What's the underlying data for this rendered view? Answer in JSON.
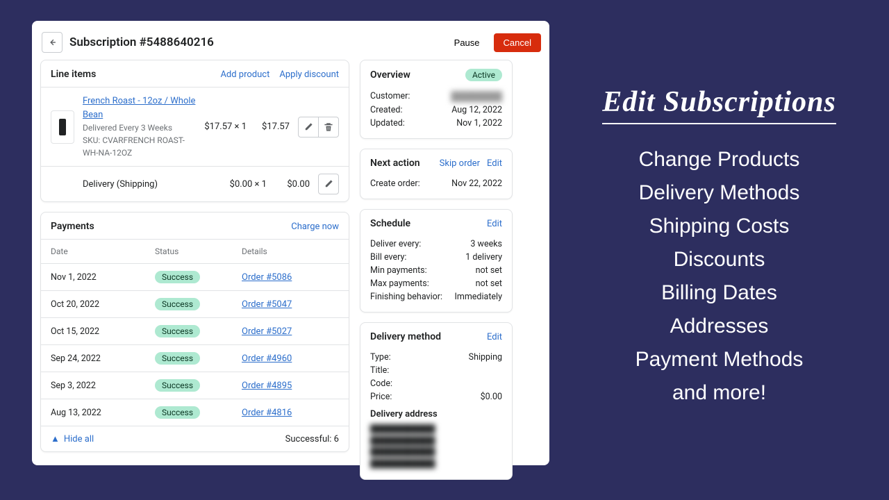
{
  "header": {
    "title": "Subscription #5488640216",
    "pause": "Pause",
    "cancel": "Cancel"
  },
  "lineItems": {
    "title": "Line items",
    "addProduct": "Add product",
    "applyDiscount": "Apply discount",
    "item": {
      "name": "French Roast - 12oz / Whole Bean",
      "schedule": "Delivered Every 3 Weeks",
      "sku": "SKU: CVARFRENCH ROAST-WH-NA-12OZ",
      "unitPrice": "$17.57 × 1",
      "total": "$17.57"
    },
    "delivery": {
      "label": "Delivery (Shipping)",
      "unitPrice": "$0.00 × 1",
      "total": "$0.00"
    }
  },
  "payments": {
    "title": "Payments",
    "chargeNow": "Charge now",
    "cols": {
      "date": "Date",
      "status": "Status",
      "details": "Details"
    },
    "rows": [
      {
        "date": "Nov 1, 2022",
        "status": "Success",
        "order": "Order #5086"
      },
      {
        "date": "Oct 20, 2022",
        "status": "Success",
        "order": "Order #5047"
      },
      {
        "date": "Oct 15, 2022",
        "status": "Success",
        "order": "Order #5027"
      },
      {
        "date": "Sep 24, 2022",
        "status": "Success",
        "order": "Order #4960"
      },
      {
        "date": "Sep 3, 2022",
        "status": "Success",
        "order": "Order #4895"
      },
      {
        "date": "Aug 13, 2022",
        "status": "Success",
        "order": "Order #4816"
      }
    ],
    "hideAll": "Hide all",
    "successful": "Successful: 6"
  },
  "overview": {
    "title": "Overview",
    "badge": "Active",
    "customerLabel": "Customer:",
    "customerBlur": "████████",
    "createdLabel": "Created:",
    "created": "Aug 12, 2022",
    "updatedLabel": "Updated:",
    "updated": "Nov 1, 2022"
  },
  "nextAction": {
    "title": "Next action",
    "skip": "Skip order",
    "edit": "Edit",
    "createLabel": "Create order:",
    "create": "Nov 22, 2022"
  },
  "schedule": {
    "title": "Schedule",
    "edit": "Edit",
    "deliverEveryLabel": "Deliver every:",
    "deliverEvery": "3 weeks",
    "billEveryLabel": "Bill every:",
    "billEvery": "1 delivery",
    "minLabel": "Min payments:",
    "min": "not set",
    "maxLabel": "Max payments:",
    "max": "not set",
    "finishLabel": "Finishing behavior:",
    "finish": "Immediately"
  },
  "deliveryMethod": {
    "title": "Delivery method",
    "edit": "Edit",
    "typeLabel": "Type:",
    "type": "Shipping",
    "titleLabel": "Title:",
    "titleVal": "",
    "codeLabel": "Code:",
    "codeVal": "",
    "priceLabel": "Price:",
    "price": "$0.00",
    "addressTitle": "Delivery address",
    "addressBlur": "████████████\n████████████\n████████████\n████████████"
  },
  "promo": {
    "heading": "Edit Subscriptions",
    "lines": [
      "Change Products",
      "Delivery Methods",
      "Shipping Costs",
      "Discounts",
      "Billing Dates",
      "Addresses",
      "Payment Methods",
      "and more!"
    ]
  }
}
